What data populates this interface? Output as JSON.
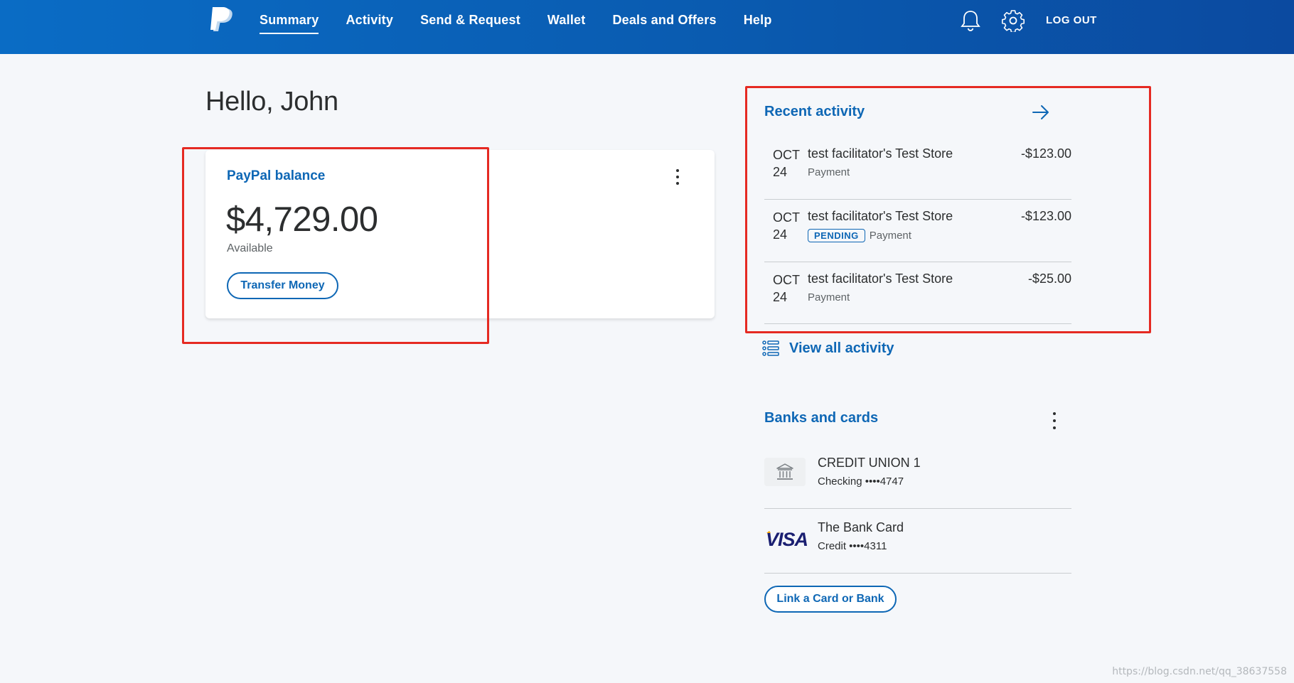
{
  "header": {
    "nav": [
      {
        "label": "Summary",
        "active": true
      },
      {
        "label": "Activity"
      },
      {
        "label": "Send & Request"
      },
      {
        "label": "Wallet"
      },
      {
        "label": "Deals and Offers"
      },
      {
        "label": "Help"
      }
    ],
    "logout_label": "LOG OUT",
    "icons": [
      "paypal-logo-icon",
      "bell-icon",
      "gear-icon"
    ],
    "brand_color": "#0a5bb0"
  },
  "greeting": "Hello, John",
  "balance": {
    "title": "PayPal balance",
    "amount": "$4,729.00",
    "sub": "Available",
    "transfer_label": "Transfer Money"
  },
  "recent": {
    "title": "Recent activity",
    "items": [
      {
        "month": "OCT",
        "day": "24",
        "name": "test facilitator's Test Store",
        "type": "Payment",
        "badge": "",
        "amount": "-$123.00"
      },
      {
        "month": "OCT",
        "day": "24",
        "name": "test facilitator's Test Store",
        "type": "Payment",
        "badge": "PENDING",
        "amount": "-$123.00"
      },
      {
        "month": "OCT",
        "day": "24",
        "name": "test facilitator's Test Store",
        "type": "Payment",
        "badge": "",
        "amount": "-$25.00"
      }
    ],
    "view_all_label": "View all activity"
  },
  "banks": {
    "title": "Banks and cards",
    "items": [
      {
        "name": "CREDIT UNION 1",
        "sub": "Checking ••••4747",
        "icon": "bank-icon"
      },
      {
        "name": "The Bank Card",
        "sub": "Credit ••••4311",
        "icon": "visa-icon"
      }
    ],
    "link_label": "Link a Card or Bank"
  },
  "watermark": "https://blog.csdn.net/qq_38637558",
  "colors": {
    "accent": "#0e67b5",
    "annotation": "#e52a22"
  }
}
